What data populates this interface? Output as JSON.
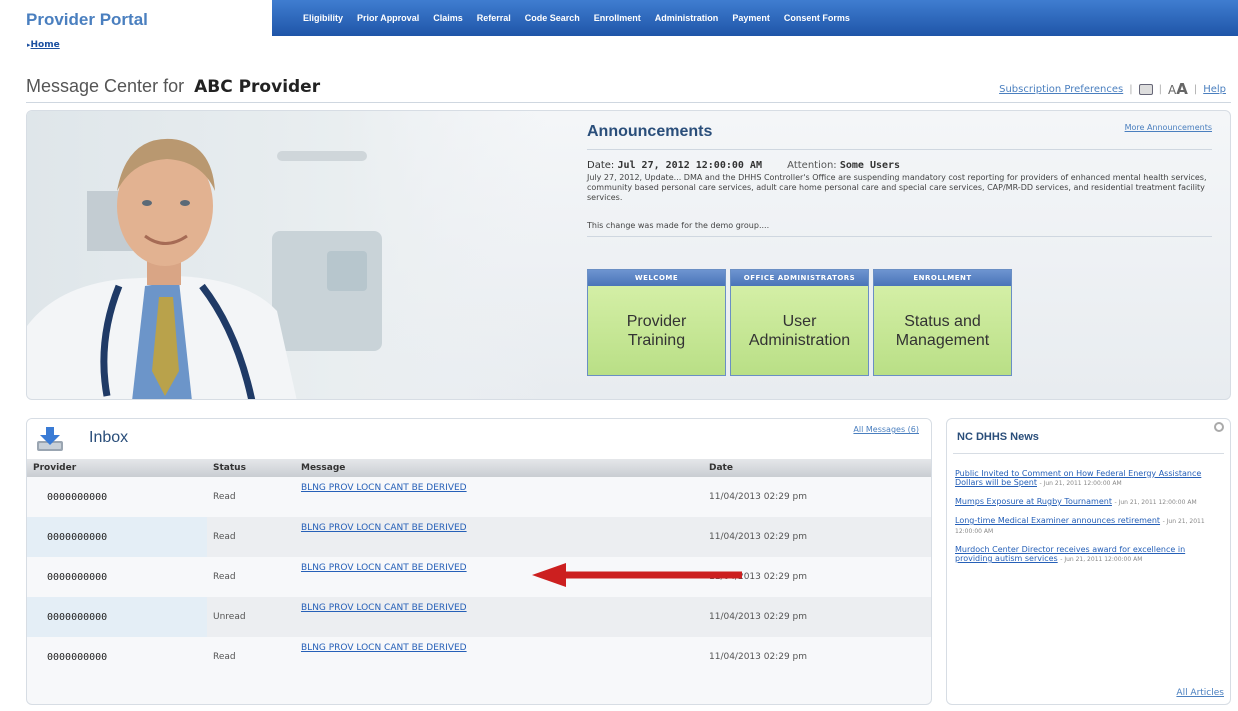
{
  "header": {
    "brand": "Provider Portal",
    "breadcrumb": "Home",
    "nav": [
      "Eligibility",
      "Prior Approval",
      "Claims",
      "Referral",
      "Code Search",
      "Enrollment",
      "Administration",
      "Payment",
      "Consent Forms"
    ]
  },
  "page": {
    "title_prefix": "Message Center for",
    "provider_name": "ABC Provider"
  },
  "utility": {
    "subscription": "Subscription Preferences",
    "font_size": "A",
    "font_size_large": "A",
    "help": "Help"
  },
  "announcements": {
    "title": "Announcements",
    "more_link": "More Announcements",
    "date_label": "Date:",
    "date_value": "Jul 27, 2012 12:00:00 AM",
    "attention_label": "Attention:",
    "attention_value": "Some Users",
    "body": "July 27, 2012, Update... DMA and the DHHS Controller's Office are suspending mandatory cost reporting for providers of enhanced mental health services, community based personal care services, adult care home personal care and special care services, CAP/MR-DD services, and residential treatment facility services.",
    "note": "This change was made for the demo group...."
  },
  "tiles": [
    {
      "header": "Welcome",
      "body": "Provider\nTraining"
    },
    {
      "header": "Office Administrators",
      "body": "User\nAdministration"
    },
    {
      "header": "Enrollment",
      "body": "Status and\nManagement"
    }
  ],
  "inbox": {
    "title": "Inbox",
    "all_messages": "All Messages (6)",
    "columns": [
      "Provider",
      "Status",
      "Message",
      "Date"
    ],
    "rows": [
      {
        "provider": "0000000000",
        "status": "Read",
        "message": "BLNG PROV LOCN CANT BE DERIVED",
        "date": "11/04/2013 02:29 pm"
      },
      {
        "provider": "0000000000",
        "status": "Read",
        "message": "BLNG PROV LOCN CANT BE DERIVED",
        "date": "11/04/2013 02:29 pm"
      },
      {
        "provider": "0000000000",
        "status": "Read",
        "message": "BLNG PROV LOCN CANT BE DERIVED",
        "date": "11/04/2013 02:29 pm"
      },
      {
        "provider": "0000000000",
        "status": "Unread",
        "message": "BLNG PROV LOCN CANT BE DERIVED",
        "date": "11/04/2013 02:29 pm"
      },
      {
        "provider": "0000000000",
        "status": "Read",
        "message": "BLNG PROV LOCN CANT BE DERIVED",
        "date": "11/04/2013 02:29 pm"
      }
    ]
  },
  "news": {
    "title": "NC DHHS News",
    "items": [
      {
        "headline": "Public Invited to Comment on How Federal Energy Assistance Dollars will be Spent",
        "date": "- Jun 21, 2011 12:00:00 AM"
      },
      {
        "headline": "Mumps Exposure at Rugby Tournament",
        "date": "- Jun 21, 2011 12:00:00 AM"
      },
      {
        "headline": "Long-time Medical Examiner announces retirement",
        "date": "- Jun 21, 2011 12:00:00 AM"
      },
      {
        "headline": "Murdoch Center Director receives award for excellence in providing autism services",
        "date": "- Jun 21, 2011 12:00:00 AM"
      }
    ],
    "all_articles": "All Articles"
  },
  "colors": {
    "nav_bar": "#2f6bc4",
    "tile_green": "#c6e39b",
    "link_blue": "#2660b8",
    "arrow_red": "#cc1f1f"
  }
}
